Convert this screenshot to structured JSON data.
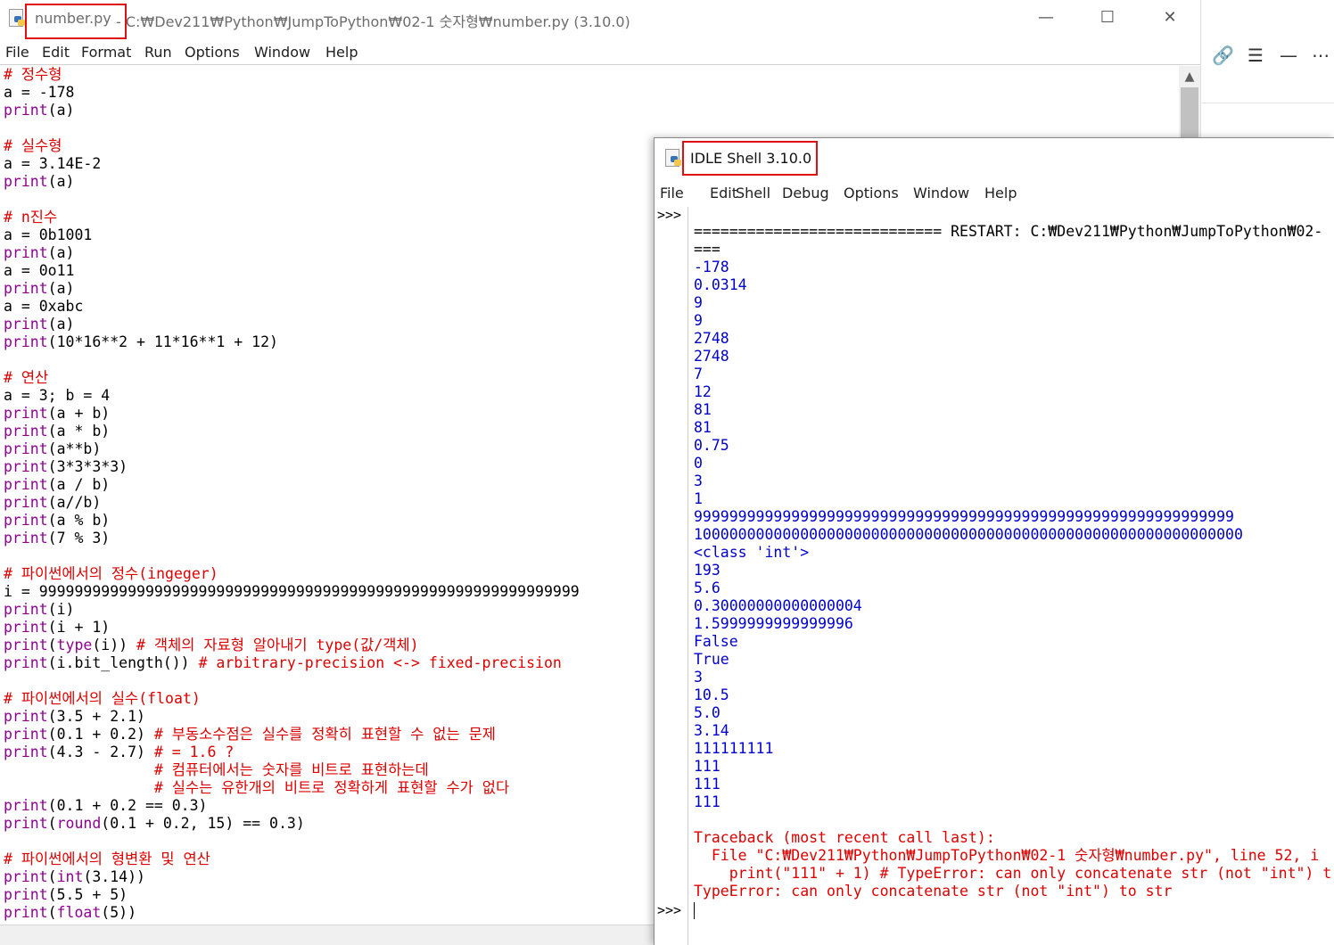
{
  "editor": {
    "title_file": "number.py",
    "title_path": " - C:₩Dev211₩Python₩JumpToPython₩02-1 숫자형₩number.py (3.10.0)",
    "menu": [
      "File",
      "Edit",
      "Format",
      "Run",
      "Options",
      "Window",
      "Help"
    ],
    "window_buttons": {
      "minimize": "—",
      "maximize": "☐",
      "close": "✕"
    },
    "code_lines": [
      "# 정수형",
      "a = -178",
      "print(a)",
      "",
      "# 실수형",
      "a = 3.14E-2",
      "print(a)",
      "",
      "# n진수",
      "a = 0b1001",
      "print(a)",
      "a = 0o11",
      "print(a)",
      "a = 0xabc",
      "print(a)",
      "print(10*16**2 + 11*16**1 + 12)",
      "",
      "# 연산",
      "a = 3; b = 4",
      "print(a + b)",
      "print(a * b)",
      "print(a**b)",
      "print(3*3*3*3)",
      "print(a / b)",
      "print(a//b)",
      "print(a % b)",
      "print(7 % 3)",
      "",
      "# 파이썬에서의 정수(ingeger)",
      "i = 9999999999999999999999999999999999999999999999999999999999999",
      "print(i)",
      "print(i + 1)",
      "print(type(i)) # 객체의 자료형 알아내기 type(값/객체)",
      "print(i.bit_length()) # arbitrary-precision <-> fixed-precision",
      "",
      "# 파이썬에서의 실수(float)",
      "print(3.5 + 2.1)",
      "print(0.1 + 0.2) # 부동소수점은 실수를 정확히 표현할 수 없는 문제",
      "print(4.3 - 2.7) # = 1.6 ?",
      "                 # 컴퓨터에서는 숫자를 비트로 표현하는데",
      "                 # 실수는 유한개의 비트로 정확하게 표현할 수가 없다",
      "print(0.1 + 0.2 == 0.3)",
      "print(round(0.1 + 0.2, 15) == 0.3)",
      "",
      "# 파이썬에서의 형변환 및 연산",
      "print(int(3.14))",
      "print(5.5 + 5)",
      "print(float(5))"
    ]
  },
  "shell": {
    "title": "IDLE Shell 3.10.0",
    "menu": [
      "File",
      "Edit",
      "Shell",
      "Debug",
      "Options",
      "Window",
      "Help"
    ],
    "prompt": ">>>",
    "restart_line": "============================ RESTART: C:₩Dev211₩Python₩JumpToPython₩02-",
    "restart_tail": "===",
    "outputs": [
      "-178",
      "0.0314",
      "9",
      "9",
      "2748",
      "2748",
      "7",
      "12",
      "81",
      "81",
      "0.75",
      "0",
      "3",
      "1",
      "9999999999999999999999999999999999999999999999999999999999999",
      "10000000000000000000000000000000000000000000000000000000000000",
      "<class 'int'>",
      "193",
      "5.6",
      "0.30000000000000004",
      "1.5999999999999996",
      "False",
      "True",
      "3",
      "10.5",
      "5.0",
      "3.14",
      "111111111",
      "111",
      "111",
      "111"
    ],
    "traceback": [
      "Traceback (most recent call last):",
      "  File \"C:₩Dev211₩Python₩JumpToPython₩02-1 숫자형₩number.py\", line 52, i",
      "    print(\"111\" + 1) # TypeError: can only concatenate str (not \"int\") t",
      "TypeError: can only concatenate str (not \"int\") to str"
    ]
  },
  "colors": {
    "comment": "#dd0000",
    "builtin": "#900090",
    "output": "#0000cc",
    "error": "#dd0000",
    "highlight_box": "#e01010"
  }
}
